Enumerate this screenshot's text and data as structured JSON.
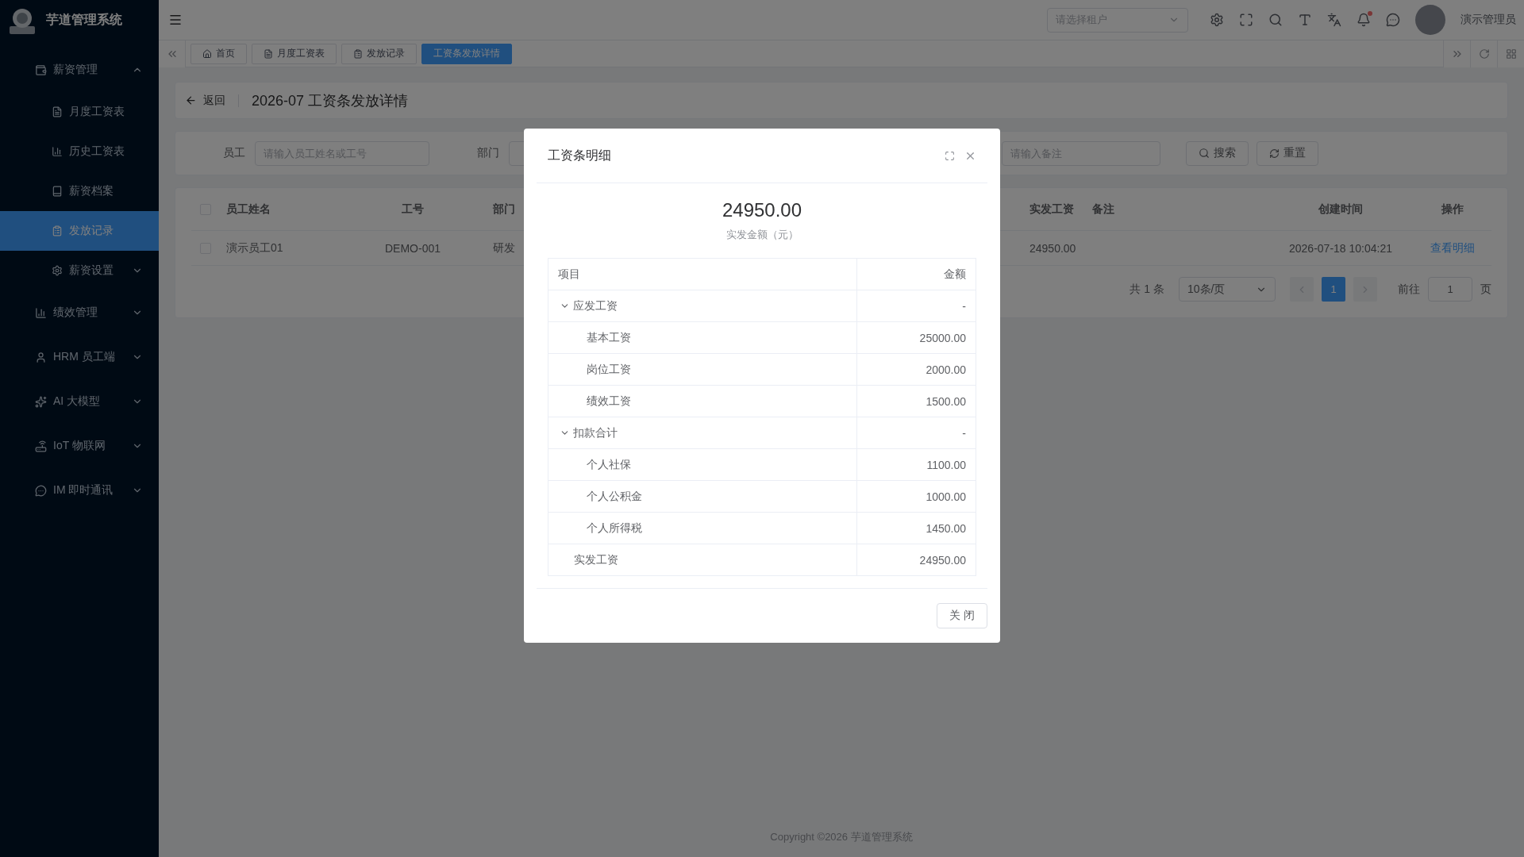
{
  "sidebar": {
    "title": "芋道管理系统",
    "items": [
      {
        "label": "薪资管理",
        "expanded": true,
        "selected": false,
        "children": [
          {
            "label": "月度工资表",
            "kind": "link",
            "selected": false
          },
          {
            "label": "历史工资表",
            "kind": "link",
            "selected": false
          },
          {
            "label": "薪资档案",
            "kind": "link",
            "selected": false
          },
          {
            "label": "发放记录",
            "kind": "link",
            "selected": true
          },
          {
            "label": "薪资设置",
            "kind": "group",
            "expanded": false,
            "selected": false
          }
        ]
      },
      {
        "label": "绩效管理",
        "expanded": false,
        "selected": false
      },
      {
        "label": "HRM 员工端",
        "expanded": false,
        "selected": false
      },
      {
        "label": "AI 大模型",
        "expanded": false,
        "selected": false
      },
      {
        "label": "IoT 物联网",
        "expanded": false,
        "selected": false
      },
      {
        "label": "IM 即时通讯",
        "expanded": false,
        "selected": false
      }
    ]
  },
  "header": {
    "tenant_select": {
      "placeholder": "请选择租户"
    },
    "user": {
      "name": "演示管理员"
    }
  },
  "tabs": [
    {
      "label": "首页",
      "selected": false
    },
    {
      "label": "月度工资表",
      "selected": false
    },
    {
      "label": "发放记录",
      "selected": false
    },
    {
      "label": "工资条发放详情",
      "selected": true
    }
  ],
  "page_header": {
    "back": "返回",
    "title": "2026-07 工资条发放详情"
  },
  "filters": {
    "fields": [
      {
        "label": "员工",
        "placeholder": "请输入员工姓名或工号"
      },
      {
        "label": "部门"
      }
    ],
    "remark": {
      "placeholder": "请输入备注"
    },
    "buttons": [
      "搜索",
      "重置"
    ]
  },
  "table": {
    "select_all": {
      "checked": false
    },
    "columns": [
      "员工姓名",
      "工号",
      "部门",
      "实发工资",
      "备注",
      "创建时间",
      "操作"
    ],
    "rows": [
      {
        "checked": false,
        "cells": [
          "演示员工01",
          "DEMO-001",
          "研发",
          "24950.00",
          "",
          "2026-07-18 10:04:21"
        ],
        "action": "查看明细"
      }
    ]
  },
  "pagination": {
    "total": "共 1 条",
    "page_size": "10条/页",
    "pages": [
      {
        "label": "1",
        "selected": true
      }
    ],
    "jump_label": "前往",
    "jump_value": "1",
    "jump_suffix": "页"
  },
  "dialog": {
    "title": "工资条明细",
    "amount": "24950.00",
    "amount_label": "实发金额（元）",
    "columns": [
      "项目",
      "金额"
    ],
    "rows": [
      {
        "kind": "group",
        "item": "应发工资",
        "amount": "-",
        "expanded": true,
        "children": [
          {
            "item": "基本工资",
            "amount": "25000.00"
          },
          {
            "item": "岗位工资",
            "amount": "2000.00"
          },
          {
            "item": "绩效工资",
            "amount": "1500.00"
          }
        ]
      },
      {
        "kind": "group",
        "item": "扣款合计",
        "amount": "-",
        "expanded": true,
        "children": [
          {
            "item": "个人社保",
            "amount": "1100.00"
          },
          {
            "item": "个人公积金",
            "amount": "1000.00"
          },
          {
            "item": "个人所得税",
            "amount": "1450.00"
          }
        ]
      },
      {
        "kind": "total",
        "item": "实发工资",
        "amount": "24950.00"
      }
    ],
    "close_button": "关 闭"
  },
  "footer": "Copyright ©2026 芋道管理系统"
}
